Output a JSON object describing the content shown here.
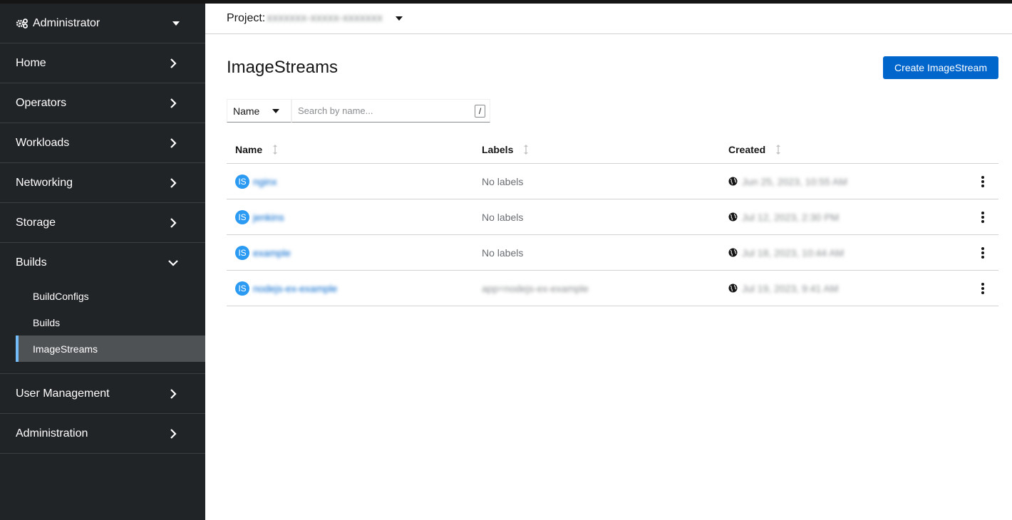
{
  "sidebar": {
    "perspective": "Administrator",
    "nav": [
      {
        "label": "Home"
      },
      {
        "label": "Operators"
      },
      {
        "label": "Workloads"
      },
      {
        "label": "Networking"
      },
      {
        "label": "Storage"
      },
      {
        "label": "Builds",
        "expanded": true,
        "children": [
          "BuildConfigs",
          "Builds",
          "ImageStreams"
        ],
        "active": "ImageStreams"
      },
      {
        "label": "User Management"
      },
      {
        "label": "Administration"
      }
    ]
  },
  "project_bar": {
    "label": "Project:",
    "name": "xxxxxxx-xxxxx-xxxxxxx"
  },
  "page": {
    "title": "ImageStreams",
    "create_button": "Create ImageStream"
  },
  "filter": {
    "select_value": "Name",
    "search_placeholder": "Search by name...",
    "shortcut": "/"
  },
  "table": {
    "columns": [
      "Name",
      "Labels",
      "Created"
    ],
    "rows": [
      {
        "badge": "IS",
        "name": "nginx",
        "labels": "No labels",
        "created": "Jun 25, 2023, 10:55 AM"
      },
      {
        "badge": "IS",
        "name": "jenkins",
        "labels": "No labels",
        "created": "Jul 12, 2023, 2:30 PM"
      },
      {
        "badge": "IS",
        "name": "example",
        "labels": "No labels",
        "created": "Jul 18, 2023, 10:44 AM"
      },
      {
        "badge": "IS",
        "name": "nodejs-ex-example",
        "labels": "app=nodejs-ex-example",
        "created": "Jul 19, 2023, 9:41 AM"
      }
    ]
  },
  "colors": {
    "sidebar_bg": "#212427",
    "active_item_bg": "#4f5255",
    "active_border": "#73bcf7",
    "primary": "#0066cc",
    "badge": "#2b9af3"
  }
}
